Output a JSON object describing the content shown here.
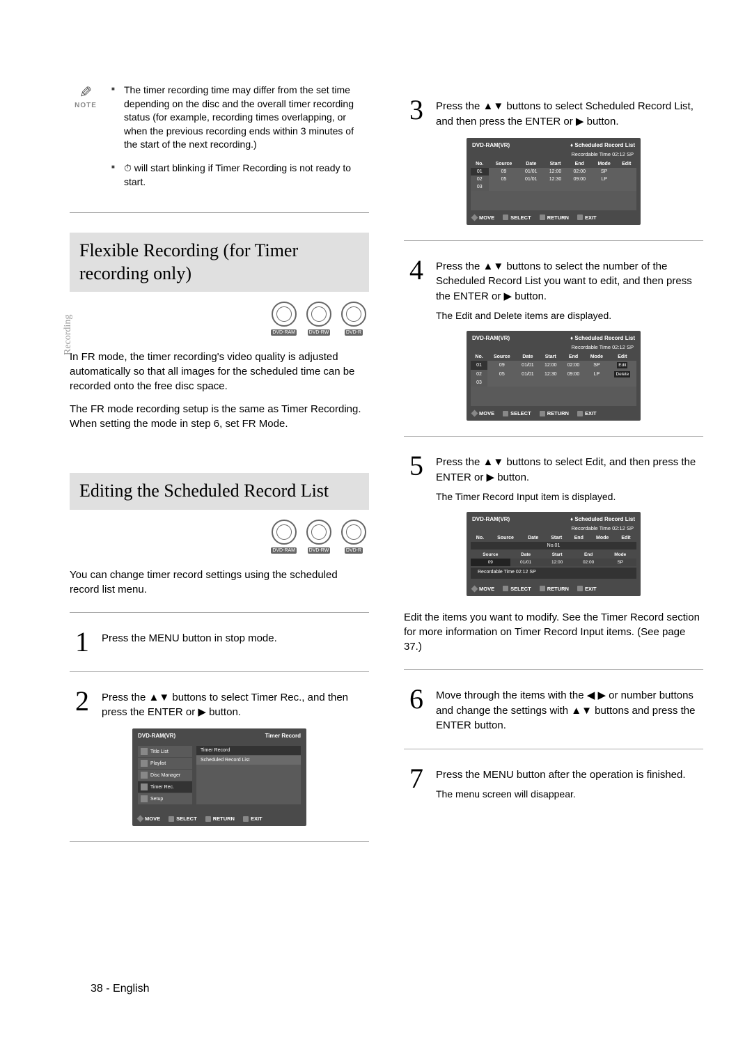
{
  "vtab": "Recording",
  "note": {
    "label": "NOTE",
    "items": [
      "The timer recording time may differ from the set time depending on the disc and the overall timer recording status (for example, recording times overlapping, or when the previous recording ends within 3 minutes of the start of the next recording.)",
      "⏱ will start blinking if Timer Recording is not ready to start."
    ]
  },
  "sections": {
    "flexible": {
      "title": "Flexible Recording (for Timer recording only)",
      "body1": "In FR mode, the timer recording's video quality is adjusted automatically so that all images for the scheduled time can be recorded onto the free disc space.",
      "body2": "The FR mode recording setup is the same as Timer Recording. When setting the mode in step 6, set FR Mode."
    },
    "editing": {
      "title": "Editing the Scheduled Record List",
      "body1": "You can change timer record settings using the scheduled record list menu."
    }
  },
  "discs": [
    "DVD-RAM",
    "DVD-RW",
    "DVD-R"
  ],
  "steps": {
    "s1": "Press the MENU button in stop mode.",
    "s2": "Press the ▲▼ buttons to select Timer Rec., and then press the ENTER or ▶ button.",
    "s3": "Press the ▲▼ buttons to select Scheduled Record List, and then press the ENTER or ▶ button.",
    "s4": {
      "main": "Press the ▲▼ buttons to select the number of the Scheduled Record List you want to edit, and then press the ENTER or ▶ button.",
      "sub": "The Edit and Delete items are displayed."
    },
    "s5": {
      "main": "Press the ▲▼ buttons to select Edit, and then press the ENTER or ▶ button.",
      "sub": "The Timer Record Input item is displayed."
    },
    "s5_after": "Edit the items you want to modify. See the Timer Record section for more information on Timer Record Input items. (See page 37.)",
    "s6": "Move through the items with the ◀ ▶ or number buttons and change the settings with ▲▼ buttons and press the ENTER button.",
    "s7": {
      "main": "Press the MENU button after the operation is finished.",
      "sub": "The menu screen will disappear."
    }
  },
  "screen_common": {
    "title_l": "DVD-RAM(VR)",
    "title_r_timer": "Timer Record",
    "title_r_sched": "Scheduled Record List",
    "rec_time": "Recordable Time 02:12 SP",
    "footer": {
      "move": "MOVE",
      "select": "SELECT",
      "return": "RETURN",
      "exit": "EXIT"
    }
  },
  "menu_screen": {
    "side": [
      "Title List",
      "Playlist",
      "Disc Manager",
      "Timer Rec.",
      "Setup"
    ],
    "panel": [
      "Timer Record",
      "Scheduled Record List"
    ]
  },
  "sched_table": {
    "cols": [
      "No.",
      "Source",
      "Date",
      "Start",
      "End",
      "Mode",
      "Edit"
    ],
    "rows": [
      {
        "no": "01",
        "src": "09",
        "date": "01/01",
        "start": "12:00",
        "end": "02:00",
        "mode": "SP",
        "edit": ""
      },
      {
        "no": "02",
        "src": "05",
        "date": "01/01",
        "start": "12:30",
        "end": "09:00",
        "mode": "LP",
        "edit": ""
      },
      {
        "no": "03",
        "src": "",
        "date": "",
        "start": "",
        "end": "",
        "mode": "",
        "edit": ""
      }
    ],
    "edit_tag": "Edit",
    "delete_tag": "Delete"
  },
  "edit_screen": {
    "no_title": "No.01",
    "cols2": [
      "Source",
      "Date",
      "Start",
      "End",
      "Mode"
    ],
    "vals": [
      "09",
      "01/01",
      "12:00",
      "02:00",
      "SP"
    ],
    "rec_time2": "Recordable Time 02:12 SP"
  },
  "page_footer": "38 - English"
}
